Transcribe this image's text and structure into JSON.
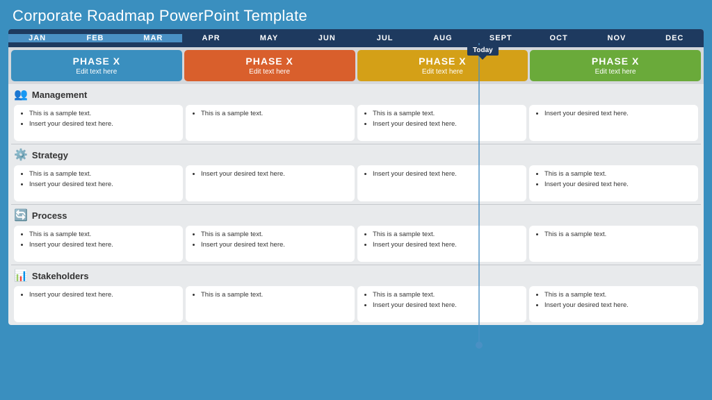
{
  "title": "Corporate Roadmap PowerPoint Template",
  "months": [
    "JAN",
    "FEB",
    "MAR",
    "APR",
    "MAY",
    "JUN",
    "JUL",
    "AUG",
    "SEPT",
    "OCT",
    "NOV",
    "DEC"
  ],
  "highlight_months": [
    "JAN",
    "FEB",
    "MAR"
  ],
  "today_label": "Today",
  "phases": [
    {
      "title": "PHASE X",
      "sub": "Edit text here",
      "color": "phase-blue"
    },
    {
      "title": "PHASE X",
      "sub": "Edit text here",
      "color": "phase-orange"
    },
    {
      "title": "PHASE X",
      "sub": "Edit text here",
      "color": "phase-yellow"
    },
    {
      "title": "PHASE X",
      "sub": "Edit text here",
      "color": "phase-green"
    }
  ],
  "categories": [
    {
      "name": "Management",
      "icon": "👥",
      "cards": [
        [
          "This is a sample text.",
          "Insert your desired text here."
        ],
        [
          "This is a sample text."
        ],
        [
          "This is a sample text.",
          "Insert your desired text here."
        ],
        [
          "Insert your desired text here."
        ]
      ]
    },
    {
      "name": "Strategy",
      "icon": "⚙️",
      "cards": [
        [
          "This is a sample text.",
          "Insert your desired text here."
        ],
        [
          "Insert your desired text here."
        ],
        [
          "Insert your desired text here."
        ],
        [
          "This is a sample text.",
          "Insert your desired text here."
        ]
      ]
    },
    {
      "name": "Process",
      "icon": "🔄",
      "cards": [
        [
          "This is a sample text.",
          "Insert your desired text here."
        ],
        [
          "This is a sample text.",
          "Insert your desired text here."
        ],
        [
          "This is a sample text.",
          "Insert your desired text here."
        ],
        [
          "This is a sample text."
        ]
      ]
    },
    {
      "name": "Stakeholders",
      "icon": "📊",
      "cards": [
        [
          "Insert your desired text here."
        ],
        [
          "This is a sample text."
        ],
        [
          "This is a sample text.",
          "Insert your desired text here."
        ],
        [
          "This is a sample text.",
          "Insert your desired text here."
        ]
      ]
    }
  ]
}
